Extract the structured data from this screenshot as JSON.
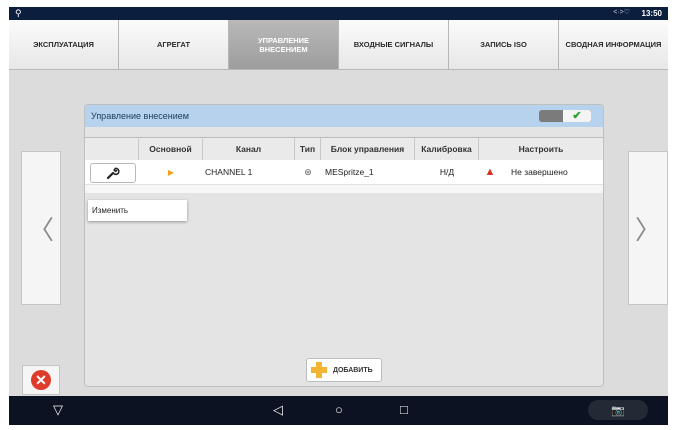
{
  "status_bar": {
    "left_icon": "usb-icon",
    "signal_icon": "signal-icon",
    "time": "13:50"
  },
  "tabs": [
    {
      "label": "ЭКСПЛУАТАЦИЯ",
      "active": false
    },
    {
      "label": "АГРЕГАТ",
      "active": false
    },
    {
      "label": "УПРАВЛЕНИЕ ВНЕСЕНИЕМ",
      "active": true
    },
    {
      "label": "ВХОДНЫЕ СИГНАЛЫ",
      "active": false
    },
    {
      "label": "ЗАПИСЬ ISO",
      "active": false
    },
    {
      "label": "СВОДНАЯ ИНФОРМАЦИЯ",
      "active": false
    }
  ],
  "panel": {
    "title": "Управление внесением",
    "toggle_on": true
  },
  "table": {
    "headers": [
      "",
      "Основной",
      "Канал",
      "Тип",
      "Блок управления",
      "Калибровка",
      "Настроить"
    ],
    "rows": [
      {
        "icon": "wrench-icon",
        "primary_marker": "▶",
        "channel": "CHANNEL 1",
        "type_icon": "dot-icon",
        "control_unit": "MESpritze_1",
        "calibration": "Н/Д",
        "status_icon": "warning-icon",
        "setup": "Не завершено"
      }
    ]
  },
  "context_menu": {
    "edit": "Изменить"
  },
  "nav": {
    "left_arrow": "〈",
    "right_arrow": "〉"
  },
  "buttons": {
    "add": "ДОБАВИТЬ"
  },
  "system_nav": {
    "logo": "▽",
    "back": "◁",
    "home": "○",
    "recent": "□",
    "screenshot": "camera-icon"
  },
  "colors": {
    "header_blue": "#b7d2ec",
    "active_tab": "#a9a9a9",
    "warning": "#d93020",
    "accent_orange": "#f0a11d",
    "status_bar": "#0b1e3e"
  }
}
